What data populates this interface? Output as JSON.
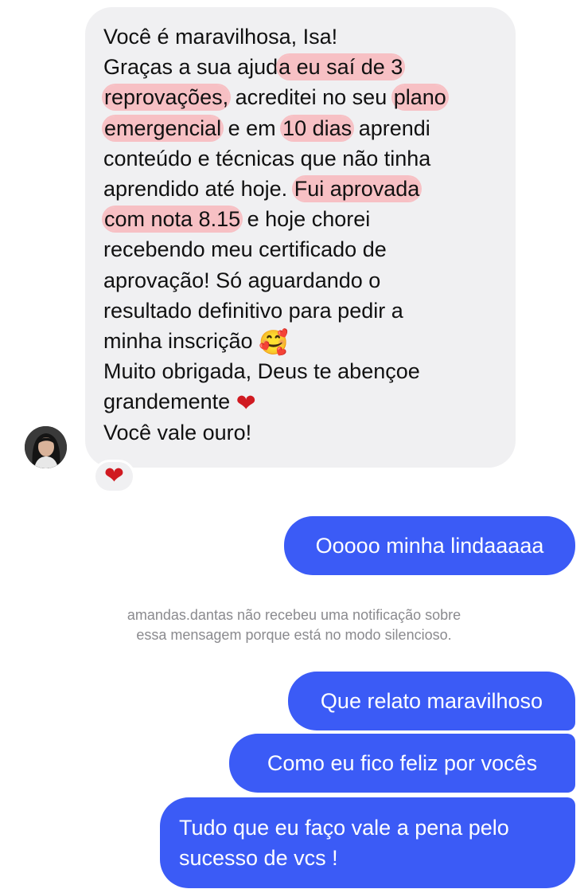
{
  "incoming_message": {
    "line1": "Você é maravilhosa, Isa!",
    "line2_a": "Graças a sua ajud",
    "line2_hl": "a eu saí de 3",
    "line3_hl": "reprovações,",
    "line3_b": " acreditei no seu ",
    "line3_hl2": "plano",
    "line4_hl": "emergencial",
    "line4_b": " e em ",
    "line4_hl2": "10 dias",
    "line4_c": " aprendi",
    "line5": "conteúdo e técnicas que não tinha",
    "line6_a": "aprendido até hoje. ",
    "line6_hl": "Fui aprovada",
    "line7_hl": "com nota 8.15",
    "line7_b": " e hoje chorei",
    "line8": "recebendo meu certificado de",
    "line9": "aprovação! Só aguardando o",
    "line10": "resultado definitivo para pedir a",
    "line11": "minha inscrição ",
    "line11_emoji": "🥰",
    "line12": "Muito obrigada, Deus te abençoe",
    "line13": "grandemente ",
    "line13_emoji": "❤",
    "line14": "Você vale ouro!",
    "reaction_emoji": "❤",
    "highlight_color": "#f7c0c4",
    "bubble_color": "#f0f0f2"
  },
  "contact": {
    "avatar_icon": "profile-photo"
  },
  "outgoing_messages": [
    {
      "text": "Ooooo minha lindaaaaa"
    },
    {
      "text": "Que relato maravilhoso"
    },
    {
      "text": "Como eu fico feliz por vocês"
    },
    {
      "line1": "Tudo que eu faço vale a pena pelo",
      "line2": "sucesso de vcs !"
    }
  ],
  "outgoing_color": "#3b5bf6",
  "silent_notice": {
    "line1": "amandas.dantas não recebeu uma notificação sobre",
    "line2": "essa mensagem porque está no modo silencioso."
  }
}
